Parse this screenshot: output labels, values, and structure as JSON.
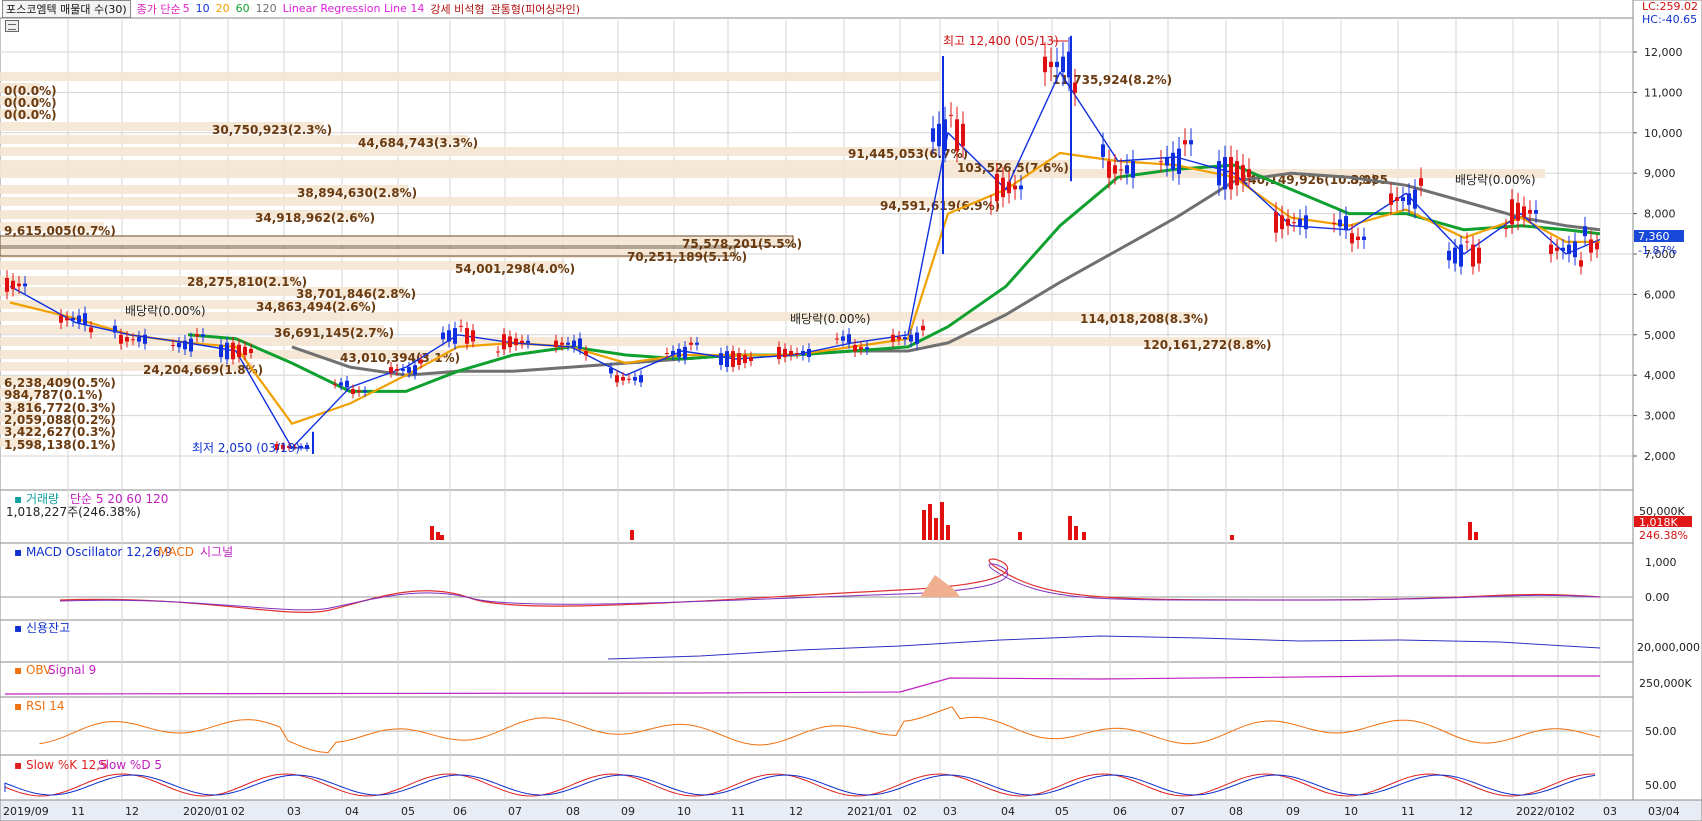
{
  "toolbar": {
    "title": "포스코엠텍 매물대 수(30)",
    "ma_label": "종가 단순",
    "ma_periods": [
      "5",
      "10",
      "20",
      "60",
      "120"
    ],
    "ma_colors": [
      "#e020c0",
      "#1030e0",
      "#f0a000",
      "#10a030",
      "#707070"
    ],
    "lr_label": "Linear Regression Line 14",
    "pattern1": "강세 비석형",
    "pattern2": "관통형(피어싱라인)"
  },
  "corner": {
    "lc": "LC:259.02",
    "hc": "HC:-40.65"
  },
  "price_axis": {
    "ticks": [
      "12,000",
      "11,000",
      "10,000",
      "9,000",
      "8,000",
      "7,000",
      "6,000",
      "5,000",
      "4,000",
      "3,000",
      "2,000"
    ]
  },
  "current_price": {
    "value": "7,360",
    "change": "-1.87%"
  },
  "annotations": {
    "high": "최고 12,400 (05/13)",
    "low": "최저 2,050 (03/19)",
    "dividend1": "배당락(0.00%)",
    "dividend2": "배당락(0.00%)",
    "dividend3": "배당락(0.00%)"
  },
  "volume_profile": [
    {
      "label": "11,735,924(8.2%)"
    },
    {
      "label": "0(0.0%)"
    },
    {
      "label": "0(0.0%)"
    },
    {
      "label": "0(0.0%)"
    },
    {
      "label": "30,750,923(2.3%)"
    },
    {
      "label": "44,684,743(3.3%)"
    },
    {
      "label": "91,445,053(6.7%)"
    },
    {
      "label": "103,526,5(7.6%)"
    },
    {
      "label": "140,149,926(10.3%)"
    },
    {
      "label": "8,985"
    },
    {
      "label": "38,894,630(2.8%)"
    },
    {
      "label": "94,591,619(6.9%)"
    },
    {
      "label": "34,918,962(2.6%)"
    },
    {
      "label": "9,615,005(0.7%)"
    },
    {
      "label": "75,578,201(5.5%)"
    },
    {
      "label": "70,251,189(5.1%)"
    },
    {
      "label": "54,001,298(4.0%)"
    },
    {
      "label": "28,275,810(2.1%)"
    },
    {
      "label": "38,701,846(2.8%)"
    },
    {
      "label": "34,863,494(2.6%)"
    },
    {
      "label": "114,018,208(8.3%)"
    },
    {
      "label": "36,691,145(2.7%)"
    },
    {
      "label": "120,161,272(8.8%)"
    },
    {
      "label": "43,010,394(3.1%)"
    },
    {
      "label": "24,204,669(1.8%)"
    },
    {
      "label": "6,238,409(0.5%)"
    },
    {
      "label": "984,787(0.1%)"
    },
    {
      "label": "3,816,772(0.3%)"
    },
    {
      "label": "2,059,088(0.2%)"
    },
    {
      "label": "3,422,627(0.3%)"
    },
    {
      "label": "1,598,138(0.1%)"
    }
  ],
  "volume_panel": {
    "label": "거래량",
    "ma_label": "단순",
    "periods": [
      "5",
      "20",
      "60",
      "120"
    ],
    "value": "1,018,227주(246.38%)",
    "axis": "50,000K",
    "badge": "1,018K",
    "pct": "246.38%"
  },
  "macd_panel": {
    "label": "MACD Oscillator 12,26,9",
    "macd": "MACD",
    "signal": "시그널",
    "ticks": [
      "1,000",
      "0.00"
    ]
  },
  "credit_panel": {
    "label": "신용잔고",
    "tick": "20,000,000"
  },
  "obv_panel": {
    "label": "OBV",
    "signal": "Signal 9",
    "tick": "250,000K"
  },
  "rsi_panel": {
    "label": "RSI 14",
    "tick": "50.00"
  },
  "stoch_panel": {
    "label": "Slow %K 12,5",
    "d": "Slow %D 5",
    "tick": "50.00"
  },
  "date_axis": [
    "2019/09",
    "11",
    "12",
    "2020/01",
    "02",
    "03",
    "04",
    "05",
    "06",
    "07",
    "08",
    "09",
    "10",
    "11",
    "12",
    "2021/01",
    "02",
    "03",
    "04",
    "05",
    "06",
    "07",
    "08",
    "09",
    "10",
    "11",
    "12",
    "2022/01",
    "02",
    "03",
    "03/04"
  ],
  "chart_data": {
    "type": "line",
    "title": "포스코엠텍 매물대 수(30)",
    "xlabel": "",
    "ylabel": "",
    "ylim": [
      1500,
      12600
    ],
    "x": [
      "2019/09",
      "2019/11",
      "2019/12",
      "2020/01",
      "2020/02",
      "2020/03",
      "2020/04",
      "2020/05",
      "2020/06",
      "2020/07",
      "2020/08",
      "2020/09",
      "2020/10",
      "2020/11",
      "2020/12",
      "2021/01",
      "2021/02",
      "2021/03",
      "2021/04",
      "2021/05",
      "2021/06",
      "2021/07",
      "2021/08",
      "2021/09",
      "2021/10",
      "2021/11",
      "2021/12",
      "2022/01",
      "2022/02",
      "2022/03"
    ],
    "series": [
      {
        "name": "5",
        "values": [
          6200,
          5300,
          5000,
          4800,
          4600,
          2200,
          3700,
          4200,
          5000,
          4800,
          4700,
          4000,
          4600,
          4400,
          4500,
          4800,
          5000,
          10000,
          8600,
          11500,
          9300,
          9400,
          9000,
          7700,
          7600,
          8500,
          7000,
          8000,
          7000,
          7360
        ]
      },
      {
        "name": "20",
        "values": [
          5800,
          5400,
          5000,
          4800,
          4700,
          2800,
          3300,
          4000,
          4700,
          4800,
          4700,
          4300,
          4500,
          4500,
          4500,
          4700,
          4900,
          8000,
          8600,
          9500,
          9300,
          9200,
          8900,
          7900,
          7700,
          8100,
          7400,
          7900,
          7300,
          7300
        ]
      },
      {
        "name": "60",
        "values": [
          null,
          null,
          null,
          5000,
          4900,
          4300,
          3600,
          3600,
          4100,
          4500,
          4700,
          4500,
          4400,
          4500,
          4500,
          4600,
          4700,
          5200,
          6200,
          7700,
          8900,
          9100,
          9200,
          8600,
          8000,
          8000,
          7600,
          7700,
          7600,
          7500
        ]
      },
      {
        "name": "120",
        "values": [
          null,
          null,
          null,
          null,
          null,
          4700,
          4200,
          4000,
          4100,
          4100,
          4200,
          4300,
          4400,
          4500,
          4500,
          4600,
          4600,
          4800,
          5500,
          6300,
          7100,
          7900,
          8800,
          9000,
          8900,
          8700,
          8300,
          7900,
          7700,
          7600
        ]
      }
    ],
    "high": {
      "value": 12400,
      "date": "05/13"
    },
    "low": {
      "value": 2050,
      "date": "03/19"
    },
    "grid": true
  }
}
